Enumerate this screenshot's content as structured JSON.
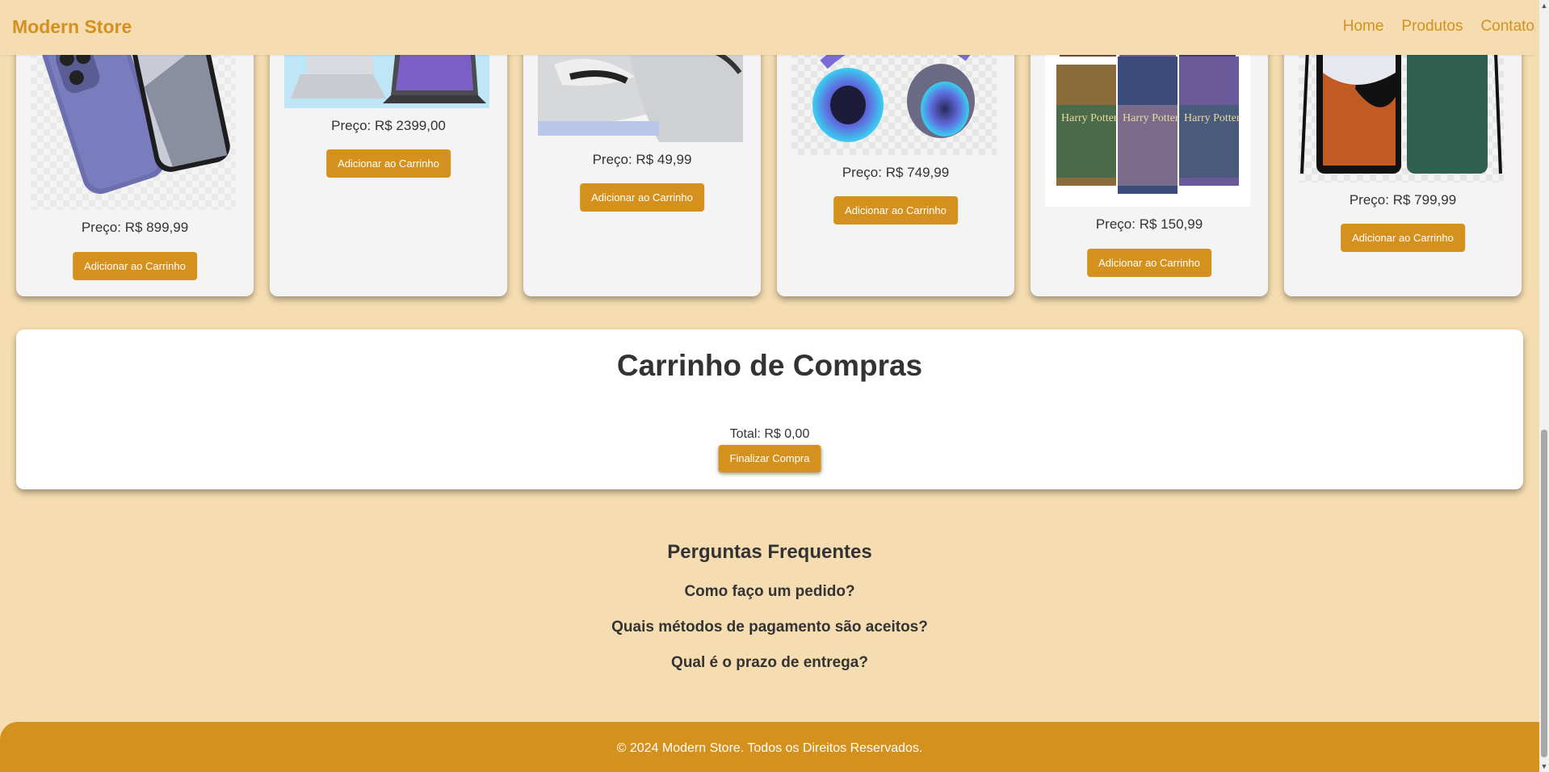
{
  "header": {
    "logo": "Modern Store",
    "nav": [
      "Home",
      "Produtos",
      "Contato"
    ]
  },
  "products": [
    {
      "image": "phone-blue",
      "price": "Preço: R$ 899,99",
      "button": "Adicionar ao Carrinho"
    },
    {
      "image": "laptops",
      "price": "Preço: R$ 2399,00",
      "button": "Adicionar ao Carrinho"
    },
    {
      "image": "sneakers",
      "price": "Preço: R$ 49,99",
      "button": "Adicionar ao Carrinho"
    },
    {
      "image": "headphones",
      "price": "Preço: R$ 749,99",
      "button": "Adicionar ao Carrinho"
    },
    {
      "image": "harry-potter-books",
      "price": "Preço: R$ 150,99",
      "button": "Adicionar ao Carrinho"
    },
    {
      "image": "galaxy-phones",
      "price": "Preço: R$ 799,99",
      "button": "Adicionar ao Carrinho"
    }
  ],
  "cart": {
    "title": "Carrinho de Compras",
    "total": "Total: R$ 0,00",
    "checkout_button": "Finalizar Compra"
  },
  "faq": {
    "title": "Perguntas Frequentes",
    "questions": [
      "Como faço um pedido?",
      "Quais métodos de pagamento são aceitos?",
      "Qual é o prazo de entrega?"
    ]
  },
  "footer": {
    "text": "© 2024 Modern Store. Todos os Direitos Reservados."
  },
  "colors": {
    "background": "#f5dcb1",
    "accent": "#d4911e",
    "card": "#f4f4f4"
  }
}
